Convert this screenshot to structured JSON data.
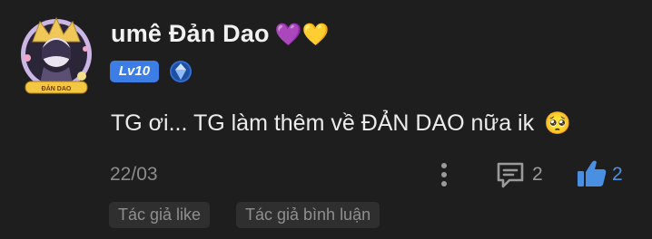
{
  "comment": {
    "username": "umê Đản Dao",
    "username_hearts": "💜💛",
    "level": "Lv10",
    "rank_icon": "diamond-shield-icon",
    "avatar_caption": "ĐẢN DAO",
    "text": "TG ơi... TG làm thêm về ĐẢN DAO nữa ik",
    "text_emoji": "🥺",
    "date": "22/03",
    "reply_count": "2",
    "like_count": "2",
    "tags": [
      "Tác giả like",
      "Tác giả bình luận"
    ]
  },
  "colors": {
    "background": "#1e1e1f",
    "level_badge": "#3d7ee6",
    "like_accent": "#4a90e2",
    "tag_background": "#2f2f30"
  }
}
